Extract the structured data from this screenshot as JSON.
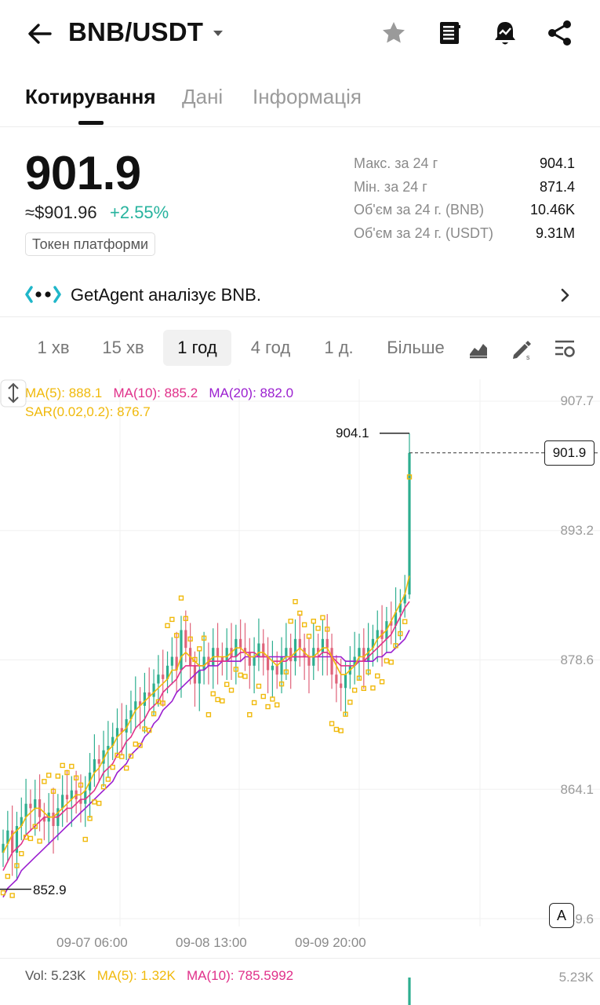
{
  "header": {
    "pair": "BNB/USDT",
    "icons": [
      "back-arrow-icon",
      "caret-down-icon",
      "star-icon",
      "notebook-icon",
      "alert-bell-icon",
      "share-icon"
    ]
  },
  "tabs": [
    "Котирування",
    "Дані",
    "Інформація"
  ],
  "price": {
    "last": "901.9",
    "usd": "≈$901.96",
    "change": "+2.55%",
    "badge": "Токен платформи"
  },
  "stats": [
    {
      "label": "Макс. за 24 г",
      "value": "904.1"
    },
    {
      "label": "Мін. за 24 г",
      "value": "871.4"
    },
    {
      "label": "Об'єм за 24 г. (BNB)",
      "value": "10.46K"
    },
    {
      "label": "Об'єм за 24 г. (USDT)",
      "value": "9.31M"
    }
  ],
  "agent": {
    "text": "GetAgent аналізує BNB."
  },
  "intervals": [
    "1 хв",
    "15 хв",
    "1 год",
    "4 год",
    "1 д.",
    "Більше"
  ],
  "active_interval": "1 год",
  "indicators": {
    "ma5": "MA(5): 888.1",
    "ma10": "MA(10): 885.2",
    "ma20": "MA(20): 882.0",
    "sar": "SAR(0.02,0.2): 876.7"
  },
  "chart_labels": {
    "current": "901.9",
    "high": "904.1",
    "low": "852.9",
    "auto": "A"
  },
  "vol": {
    "vol": "Vol: 5.23K",
    "ma5": "MA(5): 1.32K",
    "ma10": "MA(10): 785.5992",
    "max": "5.23K"
  },
  "colors": {
    "up": "#2dae8f",
    "down": "#e0637a",
    "ma5": "#f0b90b",
    "ma10": "#e0308a",
    "ma20": "#9b1fd0",
    "sar": "#f0b90b",
    "positive": "#27b39e"
  },
  "chart_data": {
    "type": "candlestick",
    "y_ticks": [
      "907.7",
      "893.2",
      "878.6",
      "864.1",
      "849.6"
    ],
    "x_ticks": [
      "09-07 06:00",
      "09-08 13:00",
      "09-09 20:00"
    ],
    "ylim": [
      849.6,
      907.7
    ],
    "high": 904.1,
    "low": 852.9,
    "last": 901.9,
    "close_path": [
      858,
      859.5,
      857,
      860,
      861,
      862.5,
      862,
      863,
      861,
      860.5,
      861.5,
      860,
      862,
      863.5,
      863,
      864,
      863,
      862.5,
      864,
      866,
      867.5,
      867,
      868.5,
      869,
      870,
      871,
      870.5,
      872,
      873,
      874,
      873.5,
      875,
      874.5,
      876,
      877,
      876.5,
      878,
      879,
      877.5,
      882,
      880,
      878,
      876,
      877.5,
      879,
      878,
      880,
      879,
      878.5,
      880,
      879,
      881,
      880,
      879.5,
      878,
      879,
      880.5,
      879,
      877.5,
      878,
      877,
      879,
      880,
      878.5,
      881,
      880,
      879,
      878,
      880,
      879.5,
      881,
      880,
      877,
      876,
      875.5,
      877,
      878,
      879,
      880,
      878.5,
      880,
      881,
      882,
      881,
      883,
      882.5,
      884,
      885,
      886,
      901.9
    ],
    "ma5_path": [
      857,
      858,
      859,
      859.5,
      860,
      861,
      861.5,
      862,
      862,
      861.5,
      861,
      861,
      861.5,
      862,
      862.5,
      863,
      863.5,
      863.5,
      864,
      865,
      866,
      866.5,
      867.5,
      868.5,
      869,
      870,
      870.5,
      871,
      872,
      873,
      873.5,
      874,
      874.5,
      875,
      875.5,
      876,
      876.5,
      877.5,
      877.5,
      879,
      879.5,
      879,
      878.5,
      878,
      878,
      878.5,
      879,
      879,
      879,
      879,
      879.5,
      880,
      880,
      879.5,
      879,
      879,
      879.5,
      879.5,
      879,
      878.5,
      878,
      878.5,
      879,
      879,
      879.5,
      880,
      879.5,
      879,
      879,
      879.5,
      880,
      880,
      879,
      878,
      877,
      877,
      877.5,
      878,
      879,
      879,
      879.5,
      880,
      881,
      881.5,
      882,
      883,
      884,
      885,
      886,
      888.1
    ],
    "ma10_path": [
      855,
      856,
      857,
      857.5,
      858,
      859,
      859.5,
      860,
      860.5,
      861,
      861,
      861,
      861,
      861.5,
      862,
      862,
      862.5,
      863,
      863,
      863.5,
      864,
      865,
      866,
      866.5,
      867,
      868,
      868.5,
      869.5,
      870,
      871,
      871.5,
      872,
      873,
      873.5,
      874,
      875,
      875.5,
      876,
      876.5,
      877.5,
      878,
      878,
      878,
      878,
      878,
      878.5,
      878.5,
      878.5,
      878.5,
      878.5,
      879,
      879,
      879.5,
      879.5,
      879.5,
      879.5,
      879,
      879,
      879,
      878.5,
      878.5,
      878.5,
      878.5,
      879,
      879,
      879,
      879,
      879,
      879,
      879,
      879.5,
      879.5,
      879,
      878.5,
      878,
      878,
      878,
      878,
      878.5,
      878.5,
      879,
      879.5,
      880,
      880.5,
      881,
      881.5,
      882.5,
      883.5,
      884.5,
      885.2
    ],
    "ma20_path": [
      852,
      853,
      853.5,
      854,
      855,
      855.5,
      856,
      856.5,
      857,
      857.5,
      858,
      858.5,
      859,
      859.5,
      860,
      860.5,
      861,
      861.5,
      862,
      862.5,
      863,
      863.5,
      864,
      864.5,
      865,
      866,
      866.5,
      867,
      868,
      868.5,
      869,
      870,
      870.5,
      871.5,
      872,
      873,
      873.5,
      874,
      875,
      875.5,
      876,
      876.5,
      877,
      877.5,
      877.5,
      878,
      878,
      878,
      878.5,
      878.5,
      878.5,
      878.5,
      878.5,
      879,
      879,
      879,
      879,
      879,
      879,
      879,
      879,
      879,
      879,
      879,
      879,
      879,
      879,
      879,
      879,
      879,
      879,
      879,
      879,
      879,
      879,
      878.5,
      878.5,
      878.5,
      878.5,
      878.5,
      878.5,
      878.5,
      879,
      879,
      879.5,
      879.5,
      880,
      880.5,
      881,
      882.0
    ]
  }
}
